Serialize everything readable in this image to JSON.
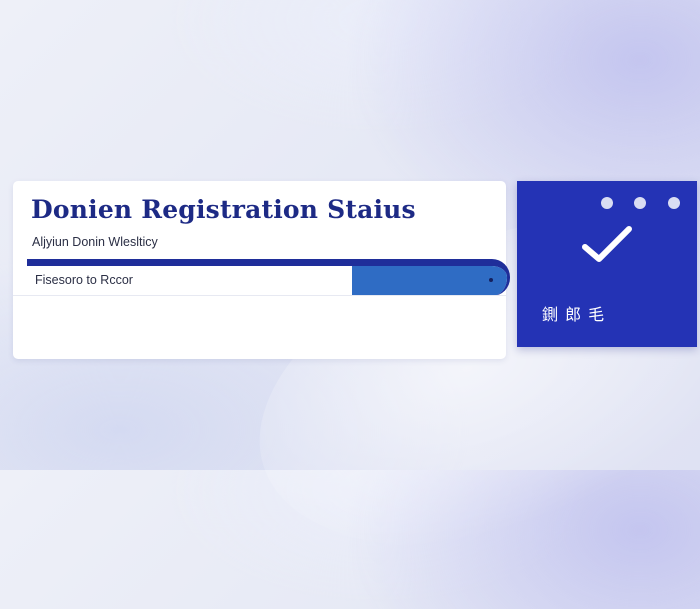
{
  "header": {
    "title": "Donien Registration Staius",
    "subtitle": "Aljyiun Donin Wleslticy"
  },
  "status": {
    "text": "Fisesoro to Rccor",
    "progress_fill_fraction": 0.32
  },
  "status_card": {
    "icon": "checkmark-icon",
    "label": "鍘 郎 毛"
  },
  "colors": {
    "title": "#1d2a85",
    "bar_border": "#1f2e9a",
    "bar_fill": "#2f6cc4",
    "card_background": "#2433b5"
  }
}
